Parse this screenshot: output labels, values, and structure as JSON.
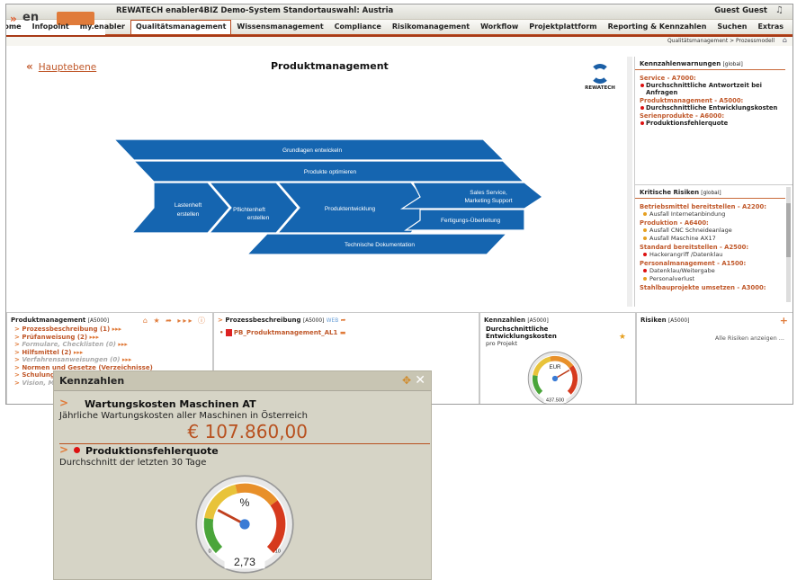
{
  "header": {
    "system_info": "REWATECH enabler4BIZ Demo-System Standortauswahl:  Austria",
    "user": "Guest Guest"
  },
  "nav": {
    "items": [
      "Home",
      "Infopoint",
      "my.enabler",
      "Qualitätsmanagement",
      "Wissensmanagement",
      "Compliance",
      "Risikomanagement",
      "Workflow",
      "Projektplattform",
      "Reporting & Kennzahlen",
      "Suchen",
      "Extras"
    ],
    "active": "Qualitätsmanagement"
  },
  "breadcrumb": "Qualitätsmanagement > Prozessmodell",
  "main": {
    "back_label": "Hauptebene",
    "title": "Produktmanagement",
    "brand": "REWATECH"
  },
  "diagram": {
    "grundlagen": "Grundlagen entwickeln",
    "optimieren": "Produkte optimieren",
    "lastenheft1": "Lastenheft",
    "lastenheft2": "erstellen",
    "pflichtenheft1": "Pflichtenheft",
    "pflichtenheft2": "erstellen",
    "produktentwicklung": "Produktentwicklung",
    "sales1": "Sales Service,",
    "sales2": "Marketing Support",
    "fertigung": "Fertigungs-Überleitung",
    "technische": "Technische Dokumentation"
  },
  "warnings": {
    "title": "Kennzahlenwarnungen",
    "scope": "[global]",
    "groups": [
      {
        "name": "Service - A7000:",
        "items": [
          "Durchschnittliche Antwortzeit bei Anfragen"
        ]
      },
      {
        "name": "Produktmanagement - A5000:",
        "items": [
          "Durchschnittliche Entwicklungskosten"
        ]
      },
      {
        "name": "Serienprodukte - A6000:",
        "items": [
          "Produktionsfehlerquote"
        ]
      }
    ]
  },
  "risks": {
    "title": "Kritische Risiken",
    "scope": "[global]",
    "groups": [
      {
        "name": "Betriebsmittel bereitstellen - A2200:",
        "items": [
          {
            "label": "Ausfall Internetanbindung",
            "level": "o"
          }
        ]
      },
      {
        "name": "Produktion - A6400:",
        "items": [
          {
            "label": "Ausfall CNC Schneideanlage",
            "level": "o"
          },
          {
            "label": "Ausfall Maschine AX17",
            "level": "o"
          }
        ]
      },
      {
        "name": "Standard bereitstellen - A2500:",
        "items": [
          {
            "label": "Hackerangriff /Datenklau",
            "level": "r"
          }
        ]
      },
      {
        "name": "Personalmanagement - A1500:",
        "items": [
          {
            "label": "Datenklau/Weitergabe",
            "level": "r"
          },
          {
            "label": "Personalverlust",
            "level": "o"
          }
        ]
      },
      {
        "name": "Stahlbauprojekte umsetzen - A3000:",
        "items": []
      }
    ]
  },
  "bottom": {
    "pm_title": "Produktmanagement",
    "pm_scope": "[A5000]",
    "pm_items": [
      {
        "label": "Prozessbeschreibung (1)",
        "gray": false
      },
      {
        "label": "Prüfanweisung (2)",
        "gray": false
      },
      {
        "label": "Formulare, Checklisten (0)",
        "gray": true
      },
      {
        "label": "Hilfsmittel (2)",
        "gray": false
      },
      {
        "label": "Verfahrensanweisungen (0)",
        "gray": true
      },
      {
        "label": "Normen und Gesetze (Verzeichnisse)",
        "gray": false
      },
      {
        "label": "Schulungen",
        "gray": false
      },
      {
        "label": "Vision, Mission",
        "gray": true
      }
    ],
    "pb_title": "Prozessbeschreibung",
    "pb_scope": "[A5000]",
    "pb_web": "WEB",
    "pb_file": "PB_Produktmanagement_AL1",
    "kz_title": "Kennzahlen",
    "kz_scope": "[A5000]",
    "kz_name": "Durchschnittliche Entwicklungskosten",
    "kz_sub": "pro Projekt",
    "kz_unit": "EUR",
    "kz_value": "437.500",
    "kz_fraction": 0.72,
    "ris_title": "Risiken",
    "ris_scope": "[A5000]",
    "ris_link": "Alle Risiken anzeigen ..."
  },
  "popup": {
    "title": "Kennzahlen",
    "k1_title": "Wartungskosten Maschinen AT",
    "k1_desc": "Jährliche Wartungskosten aller Maschinen in Österreich",
    "k1_value": "€ 107.860,00",
    "k2_title": "Produktionsfehlerquote",
    "k2_desc": "Durchschnitt der letzten 30 Tage",
    "gauge_unit": "%",
    "gauge_value": "2,73",
    "gauge_min": "0",
    "gauge_max": "10",
    "gauge_fraction": 0.27
  },
  "colors": {
    "accent": "#c0582a",
    "diagram": "#1565b0",
    "popup_bg": "#d6d4c6"
  }
}
